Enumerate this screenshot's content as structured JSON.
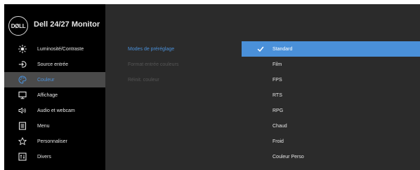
{
  "header": {
    "logo_text": "DØLL",
    "title": "Dell 24/27 Monitor"
  },
  "nav": {
    "items": [
      {
        "label": "Luminosité/Contraste",
        "icon": "brightness-icon"
      },
      {
        "label": "Source entrée",
        "icon": "input-source-icon"
      },
      {
        "label": "Couleur",
        "icon": "color-palette-icon",
        "active": true
      },
      {
        "label": "Affichage",
        "icon": "display-icon"
      },
      {
        "label": "Audio et webcam",
        "icon": "audio-webcam-icon"
      },
      {
        "label": "Menu",
        "icon": "menu-icon"
      },
      {
        "label": "Personnaliser",
        "icon": "star-icon"
      },
      {
        "label": "Divers",
        "icon": "others-icon"
      }
    ]
  },
  "submenu": {
    "items": [
      {
        "label": "Modes de préréglage",
        "state": "active"
      },
      {
        "label": "Format entrée couleurs",
        "state": "disabled"
      },
      {
        "label": "Réinit. couleur",
        "state": "disabled"
      }
    ]
  },
  "options": {
    "items": [
      {
        "label": "Standard",
        "selected": true
      },
      {
        "label": "Film"
      },
      {
        "label": "FPS"
      },
      {
        "label": "RTS"
      },
      {
        "label": "RPG"
      },
      {
        "label": "Chaud"
      },
      {
        "label": "Froid"
      },
      {
        "label": "Couleur Perso"
      }
    ]
  },
  "colors": {
    "background": "#2b2b2b",
    "sidebar": "#000000",
    "accent": "#4a90d9",
    "active_nav": "#4a4a4a",
    "text": "#e6e6e6",
    "disabled_text": "#555555"
  }
}
